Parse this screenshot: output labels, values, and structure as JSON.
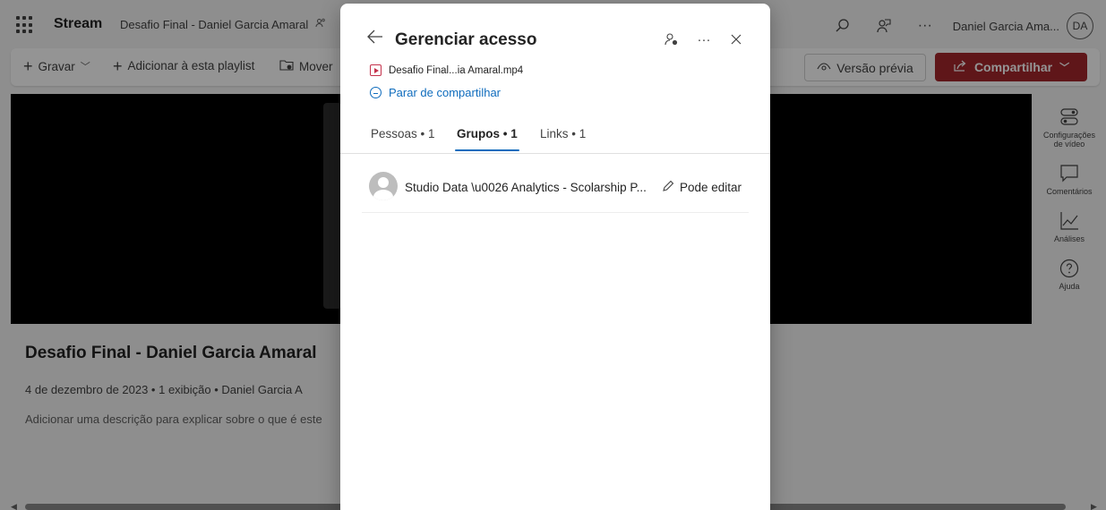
{
  "app": {
    "name": "Stream",
    "document_title": "Desafio Final - Daniel Garcia Amaral",
    "user_name": "Daniel Garcia Ama...",
    "user_initials": "DA"
  },
  "commandbar": {
    "record_label": "Gravar",
    "add_playlist_label": "Adicionar à esta playlist",
    "move_label": "Mover",
    "preview_label": "Versão prévia",
    "share_label": "Compartilhar"
  },
  "rail": {
    "items": [
      {
        "label": "Configurações de vídeo",
        "icon": "settings-toggle-icon"
      },
      {
        "label": "Comentários",
        "icon": "comment-icon"
      },
      {
        "label": "Análises",
        "icon": "chart-icon"
      },
      {
        "label": "Ajuda",
        "icon": "help-icon"
      }
    ]
  },
  "video": {
    "title": "Desafio Final - Daniel Garcia Amaral",
    "meta": "4 de dezembro de 2023  •  1 exibição  •  Daniel Garcia A",
    "description": "Adicionar uma descrição para explicar sobre o que é este"
  },
  "dialog": {
    "title": "Gerenciar acesso",
    "file_name": "Desafio Final...ia Amaral.mp4",
    "stop_sharing": "Parar de compartilhar",
    "tabs": [
      {
        "label": "Pessoas • 1",
        "active": false
      },
      {
        "label": "Grupos • 1",
        "active": true
      },
      {
        "label": "Links • 1",
        "active": false
      }
    ],
    "members": [
      {
        "name": "Studio Data \\u0026 Analytics - Scolarship P...",
        "permission": "Pode editar"
      }
    ]
  },
  "colors": {
    "accent": "#0f6cbd",
    "share_button": "#a4262c",
    "overlay": "rgba(0,0,0,0.42)"
  }
}
